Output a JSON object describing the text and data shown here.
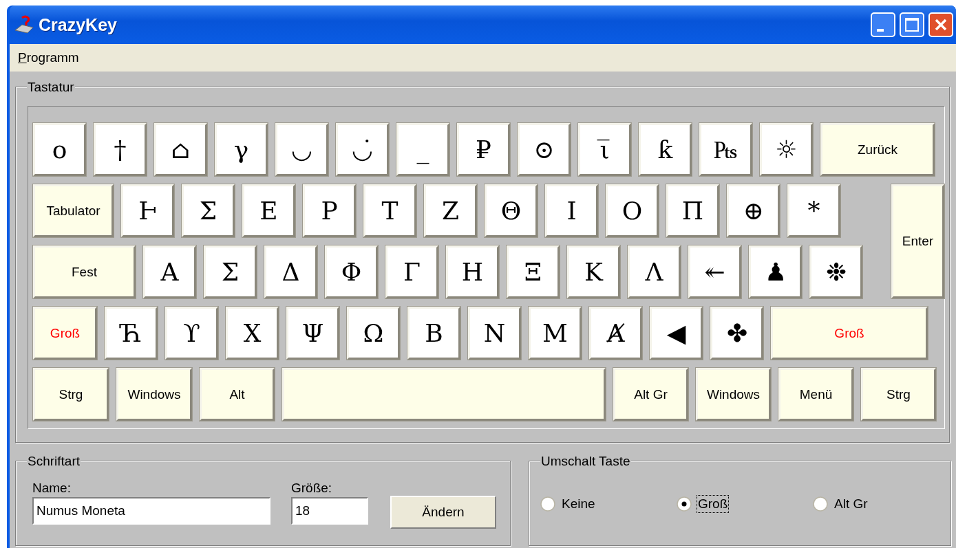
{
  "window": {
    "title": "CrazyKey"
  },
  "menu": [
    {
      "label": "Programm"
    }
  ],
  "keyboard": {
    "title": "Tastatur",
    "key_rows": [
      [
        {
          "kind": "glyph",
          "label": "ο"
        },
        {
          "kind": "glyph",
          "label": "†"
        },
        {
          "kind": "glyph",
          "label": "⌂"
        },
        {
          "kind": "glyph",
          "label": "γ"
        },
        {
          "kind": "glyph",
          "label": "◡"
        },
        {
          "kind": "glyph",
          "label": "◡̇"
        },
        {
          "kind": "glyph",
          "label": "_"
        },
        {
          "kind": "glyph",
          "label": "₽"
        },
        {
          "kind": "glyph",
          "label": "⊙"
        },
        {
          "kind": "glyph",
          "label": "ι̅"
        },
        {
          "kind": "glyph",
          "label": "ƙ"
        },
        {
          "kind": "glyph",
          "label": "₧"
        },
        {
          "kind": "glyph",
          "label": "☼"
        },
        {
          "kind": "function",
          "label": "Zurück",
          "highlighted": false
        }
      ],
      [
        {
          "kind": "function",
          "label": "Tabulator",
          "highlighted": false
        },
        {
          "kind": "glyph",
          "label": "Ⱶ"
        },
        {
          "kind": "glyph",
          "label": "Σ"
        },
        {
          "kind": "glyph",
          "label": "Ε"
        },
        {
          "kind": "glyph",
          "label": "Ρ"
        },
        {
          "kind": "glyph",
          "label": "Τ"
        },
        {
          "kind": "glyph",
          "label": "Ζ"
        },
        {
          "kind": "glyph",
          "label": "Θ"
        },
        {
          "kind": "glyph",
          "label": "Ι"
        },
        {
          "kind": "glyph",
          "label": "Ο"
        },
        {
          "kind": "glyph",
          "label": "Π"
        },
        {
          "kind": "glyph",
          "label": "⊕"
        },
        {
          "kind": "glyph",
          "label": "*"
        }
      ],
      [
        {
          "kind": "function",
          "label": "Fest",
          "highlighted": false
        },
        {
          "kind": "glyph",
          "label": "Α"
        },
        {
          "kind": "glyph",
          "label": "Σ"
        },
        {
          "kind": "glyph",
          "label": "Δ"
        },
        {
          "kind": "glyph",
          "label": "Φ"
        },
        {
          "kind": "glyph",
          "label": "Γ"
        },
        {
          "kind": "glyph",
          "label": "Η"
        },
        {
          "kind": "glyph",
          "label": "Ξ"
        },
        {
          "kind": "glyph",
          "label": "Κ"
        },
        {
          "kind": "glyph",
          "label": "Λ"
        },
        {
          "kind": "glyph",
          "label": "↞"
        },
        {
          "kind": "glyph",
          "label": "♟"
        },
        {
          "kind": "glyph",
          "label": "❉"
        }
      ],
      [
        {
          "kind": "function",
          "label": "Groß",
          "highlighted": true
        },
        {
          "kind": "glyph",
          "label": "Ћ"
        },
        {
          "kind": "glyph",
          "label": "ϒ"
        },
        {
          "kind": "glyph",
          "label": "Χ"
        },
        {
          "kind": "glyph",
          "label": "Ψ"
        },
        {
          "kind": "glyph",
          "label": "Ω"
        },
        {
          "kind": "glyph",
          "label": "Β"
        },
        {
          "kind": "glyph",
          "label": "Ν"
        },
        {
          "kind": "glyph",
          "label": "Μ"
        },
        {
          "kind": "glyph",
          "label": "Ⱥ"
        },
        {
          "kind": "glyph",
          "label": "◀"
        },
        {
          "kind": "glyph",
          "label": "✤"
        },
        {
          "kind": "function",
          "label": "Groß",
          "highlighted": true
        }
      ],
      [
        {
          "kind": "function",
          "label": "Strg",
          "highlighted": false
        },
        {
          "kind": "function",
          "label": "Windows",
          "highlighted": false
        },
        {
          "kind": "function",
          "label": "Alt",
          "highlighted": false
        },
        {
          "kind": "space"
        },
        {
          "kind": "function",
          "label": "Alt Gr",
          "highlighted": false
        },
        {
          "kind": "function",
          "label": "Windows",
          "highlighted": false
        },
        {
          "kind": "function",
          "label": "Menü",
          "highlighted": false
        },
        {
          "kind": "function",
          "label": "Strg",
          "highlighted": false
        }
      ]
    ],
    "enter": {
      "label": "Enter",
      "highlighted": false
    }
  },
  "font": {
    "title": "Schriftart",
    "name_label": "Name:",
    "name_value": "Numus Moneta",
    "size_label": "Größe:",
    "size_value": "18",
    "button": "Ändern"
  },
  "shift": {
    "title": "Umschalt Taste",
    "options": [
      {
        "label": "Keine",
        "selected": false
      },
      {
        "label": "Groß",
        "selected": true
      },
      {
        "label": "Alt Gr",
        "selected": false
      }
    ]
  }
}
